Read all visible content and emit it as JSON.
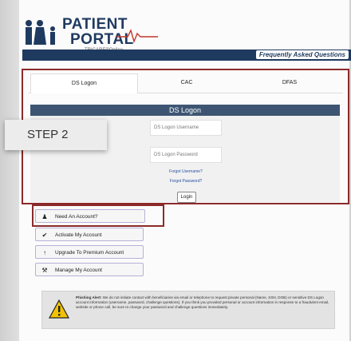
{
  "logo": {
    "line1": "PATIENT",
    "line2": "PORTAL",
    "subtitle": "TRICARE®Online"
  },
  "header": {
    "faq_label": "Frequently Asked Questions"
  },
  "tabs": [
    {
      "label": "DS Logon"
    },
    {
      "label": "CAC"
    },
    {
      "label": "DFAS"
    }
  ],
  "form": {
    "title": "DS Logon",
    "username_placeholder": "DS Logon Username",
    "password_placeholder": "DS Logon Password",
    "forgot_username": "Forgot Username?",
    "forgot_password": "Forgot Password?",
    "login_label": "Login"
  },
  "step": {
    "label": "STEP 2"
  },
  "accounts": [
    {
      "label": "Need An Account?",
      "icon": "person-icon"
    },
    {
      "label": "Activate My Account",
      "icon": "checkmark-icon"
    },
    {
      "label": "Upgrade To Premium Account",
      "icon": "up-arrow-icon"
    },
    {
      "label": "Manage My Account",
      "icon": "wrench-icon"
    }
  ],
  "alert": {
    "title": "Phishing Alert:",
    "text": "We do not initiate contact with beneficiaries via email or telephone to request private personal (Name, SSN, DOB) or sensitive DS Logon account information (username, password, challenge questions). If you think you provided personal or account information in response to a fraudulent email, website or phone call, be sure to change your password and challenge questions immediately."
  },
  "colors": {
    "navy": "#1f3a5f",
    "highlight_red": "#8b2a2a",
    "form_header": "#3d5572"
  }
}
